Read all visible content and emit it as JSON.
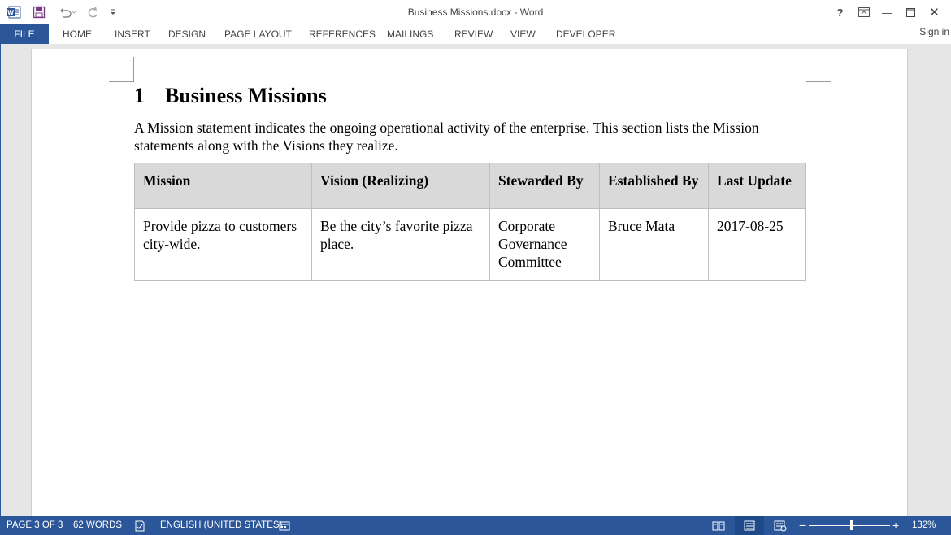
{
  "window": {
    "title": "Business Missions.docx - Word",
    "controls": {
      "help": "?",
      "minimize": "—",
      "close": "✕"
    }
  },
  "ribbon": {
    "file_tab": "FILE",
    "tabs": [
      "HOME",
      "INSERT",
      "DESIGN",
      "PAGE LAYOUT",
      "REFERENCES",
      "MAILINGS",
      "REVIEW",
      "VIEW",
      "DEVELOPER"
    ],
    "sign_in": "Sign in"
  },
  "document": {
    "heading_number": "1",
    "heading_text": "Business Missions",
    "paragraph": "A Mission statement indicates the ongoing operational activity of the enterprise. This section lists the Mission statements along with the Visions they realize.",
    "table": {
      "headers": [
        "Mission",
        "Vision (Realizing)",
        "Stewarded By",
        "Established By",
        "Last Update"
      ],
      "rows": [
        [
          "Provide pizza to customers city-wide.",
          "Be the city’s favorite pizza place.",
          "Corporate Governance Committee",
          "Bruce Mata",
          "2017-08-25"
        ]
      ]
    }
  },
  "status_bar": {
    "page": "PAGE 3 OF 3",
    "words": "62 WORDS",
    "language": "ENGLISH (UNITED STATES)",
    "zoom": "132%",
    "zoom_minus": "−",
    "zoom_plus": "+"
  },
  "colors": {
    "accent": "#2b579a"
  }
}
